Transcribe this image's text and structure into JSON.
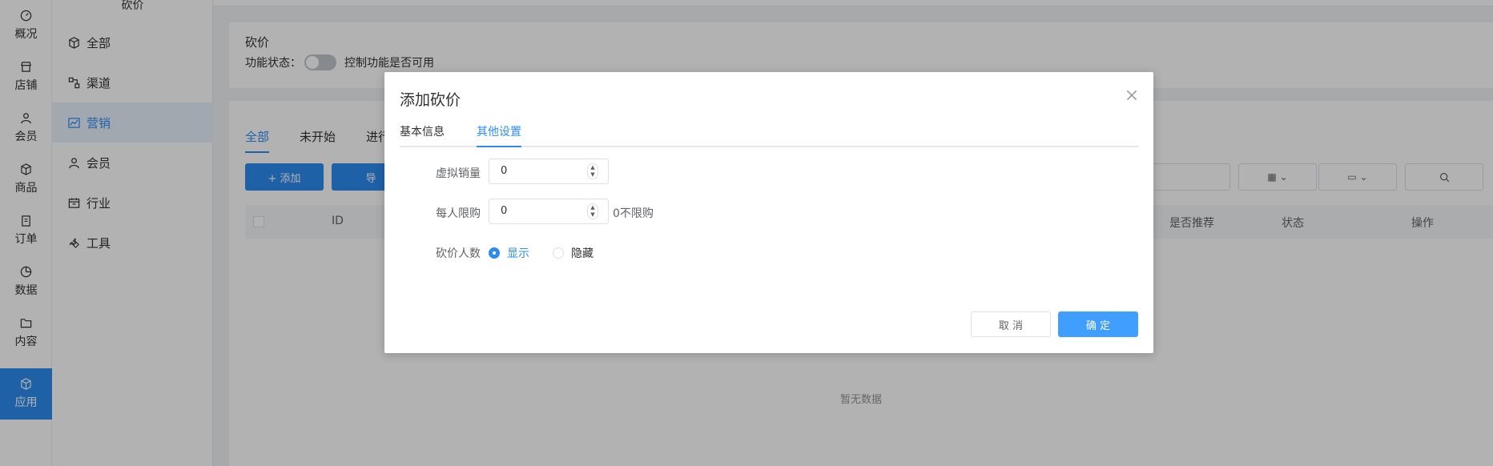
{
  "rail": {
    "items": [
      {
        "label": "概况",
        "icon": "dashboard-icon"
      },
      {
        "label": "店铺",
        "icon": "shop-icon"
      },
      {
        "label": "会员",
        "icon": "user-icon"
      },
      {
        "label": "商品",
        "icon": "box-icon"
      },
      {
        "label": "订单",
        "icon": "clipboard-icon"
      },
      {
        "label": "数据",
        "icon": "pie-chart-icon"
      },
      {
        "label": "内容",
        "icon": "folder-icon"
      },
      {
        "label": "应用",
        "icon": "app-cube-icon"
      }
    ],
    "active": "应用"
  },
  "submenu": {
    "title": "砍价",
    "items": [
      {
        "label": "全部",
        "icon": "cube-icon"
      },
      {
        "label": "渠道",
        "icon": "channel-icon"
      },
      {
        "label": "营销",
        "icon": "trend-icon"
      },
      {
        "label": "会员",
        "icon": "user-icon"
      },
      {
        "label": "行业",
        "icon": "calendar-icon"
      },
      {
        "label": "工具",
        "icon": "wrench-icon"
      }
    ],
    "active": "营销"
  },
  "page": {
    "title": "砍价",
    "status_label": "功能状态：",
    "status_hint": "控制功能是否可用",
    "tabs": [
      "全部",
      "未开始",
      "进行"
    ],
    "add_button": "+ 添加",
    "export_button": "导",
    "columns": [
      "ID",
      "是否推荐",
      "状态",
      "操作"
    ],
    "empty_text": "暂无数据"
  },
  "dialog": {
    "title": "添加砍价",
    "tabs": [
      "基本信息",
      "其他设置"
    ],
    "active_tab": "其他设置",
    "fields": {
      "virtual_sales": {
        "label": "虚拟销量",
        "value": "0"
      },
      "limit_per_user": {
        "label": "每人限购",
        "value": "0",
        "hint": "0不限购"
      },
      "bargain_count": {
        "label": "砍价人数",
        "options": [
          "显示",
          "隐藏"
        ],
        "selected": "显示"
      }
    },
    "cancel_label": "取 消",
    "ok_label": "确 定"
  },
  "colors": {
    "primary": "#2d8cf0",
    "ok_button": "#409eff",
    "overlay": "rgba(0,0,0,0.30)"
  }
}
